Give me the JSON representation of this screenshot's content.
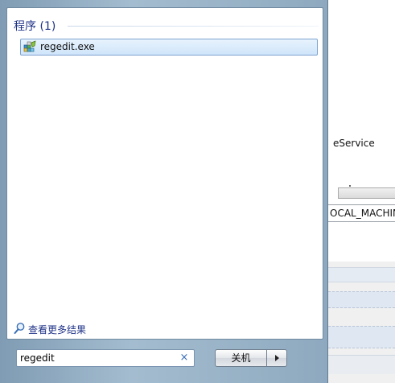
{
  "start_menu": {
    "group": {
      "name": "程序 (1)"
    },
    "results": [
      {
        "label": "regedit.exe",
        "icon": "registry-editor-icon"
      }
    ],
    "see_more": {
      "label": "查看更多结果",
      "icon": "search-icon"
    },
    "search": {
      "value": "regedit",
      "clear_icon": "×"
    },
    "shutdown": {
      "label": "关机",
      "arrow_icon": "triangle-right-icon"
    }
  },
  "background_window": {
    "service_text": "eService",
    "path_text": "OCAL_MACHIN"
  },
  "colors": {
    "group_header": "#1e3287",
    "selected_item": "#cfe5fa",
    "menu_frame": "#8ea9bf"
  }
}
